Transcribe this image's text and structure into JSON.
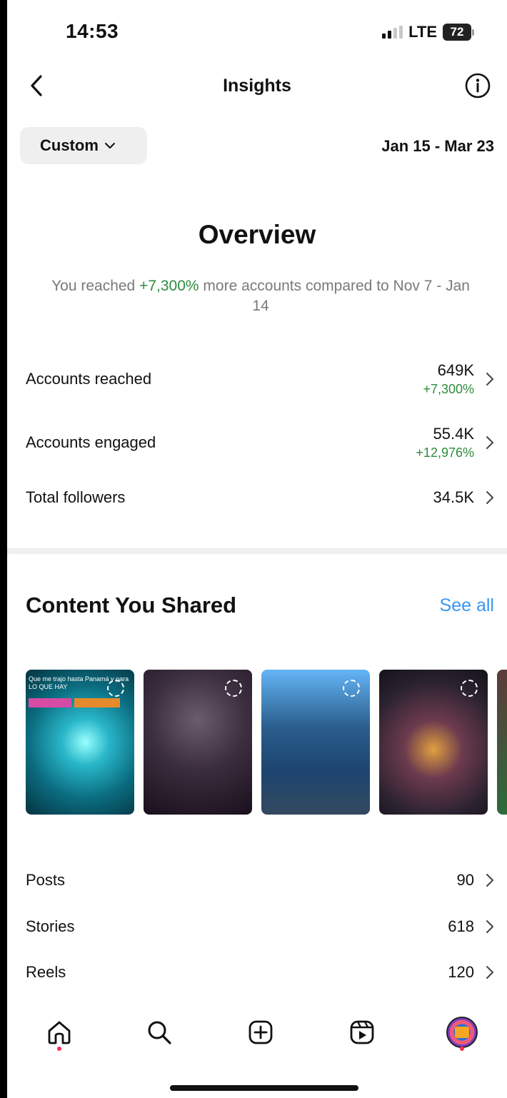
{
  "status_bar": {
    "time": "14:53",
    "network": "LTE",
    "battery": "72"
  },
  "header": {
    "title": "Insights",
    "back_icon": "chevron-left-icon",
    "info_icon": "info-icon"
  },
  "filter": {
    "period_label": "Custom",
    "date_range": "Jan 15 - Mar 23"
  },
  "overview": {
    "title": "Overview",
    "subtitle_prefix": "You reached ",
    "subtitle_highlight": "+7,300%",
    "subtitle_suffix": " more accounts compared to Nov 7 - Jan 14",
    "metrics": [
      {
        "label": "Accounts reached",
        "value": "649K",
        "delta": "+7,300%"
      },
      {
        "label": "Accounts engaged",
        "value": "55.4K",
        "delta": "+12,976%"
      },
      {
        "label": "Total followers",
        "value": "34.5K",
        "delta": ""
      }
    ]
  },
  "content": {
    "title": "Content You Shared",
    "see_all": "See all",
    "thumbnail_caption": "Que me trajo hasta Panamá y para\nLO QUE HAY",
    "counts": [
      {
        "label": "Posts",
        "value": "90"
      },
      {
        "label": "Stories",
        "value": "618"
      },
      {
        "label": "Reels",
        "value": "120"
      }
    ]
  },
  "tabbar": {
    "items": [
      "home-icon",
      "search-icon",
      "create-icon",
      "reels-icon",
      "profile-avatar"
    ]
  },
  "colors": {
    "accent_link": "#3897f0",
    "positive": "#2e8b3d",
    "notification_dot": "#ff2d55"
  }
}
